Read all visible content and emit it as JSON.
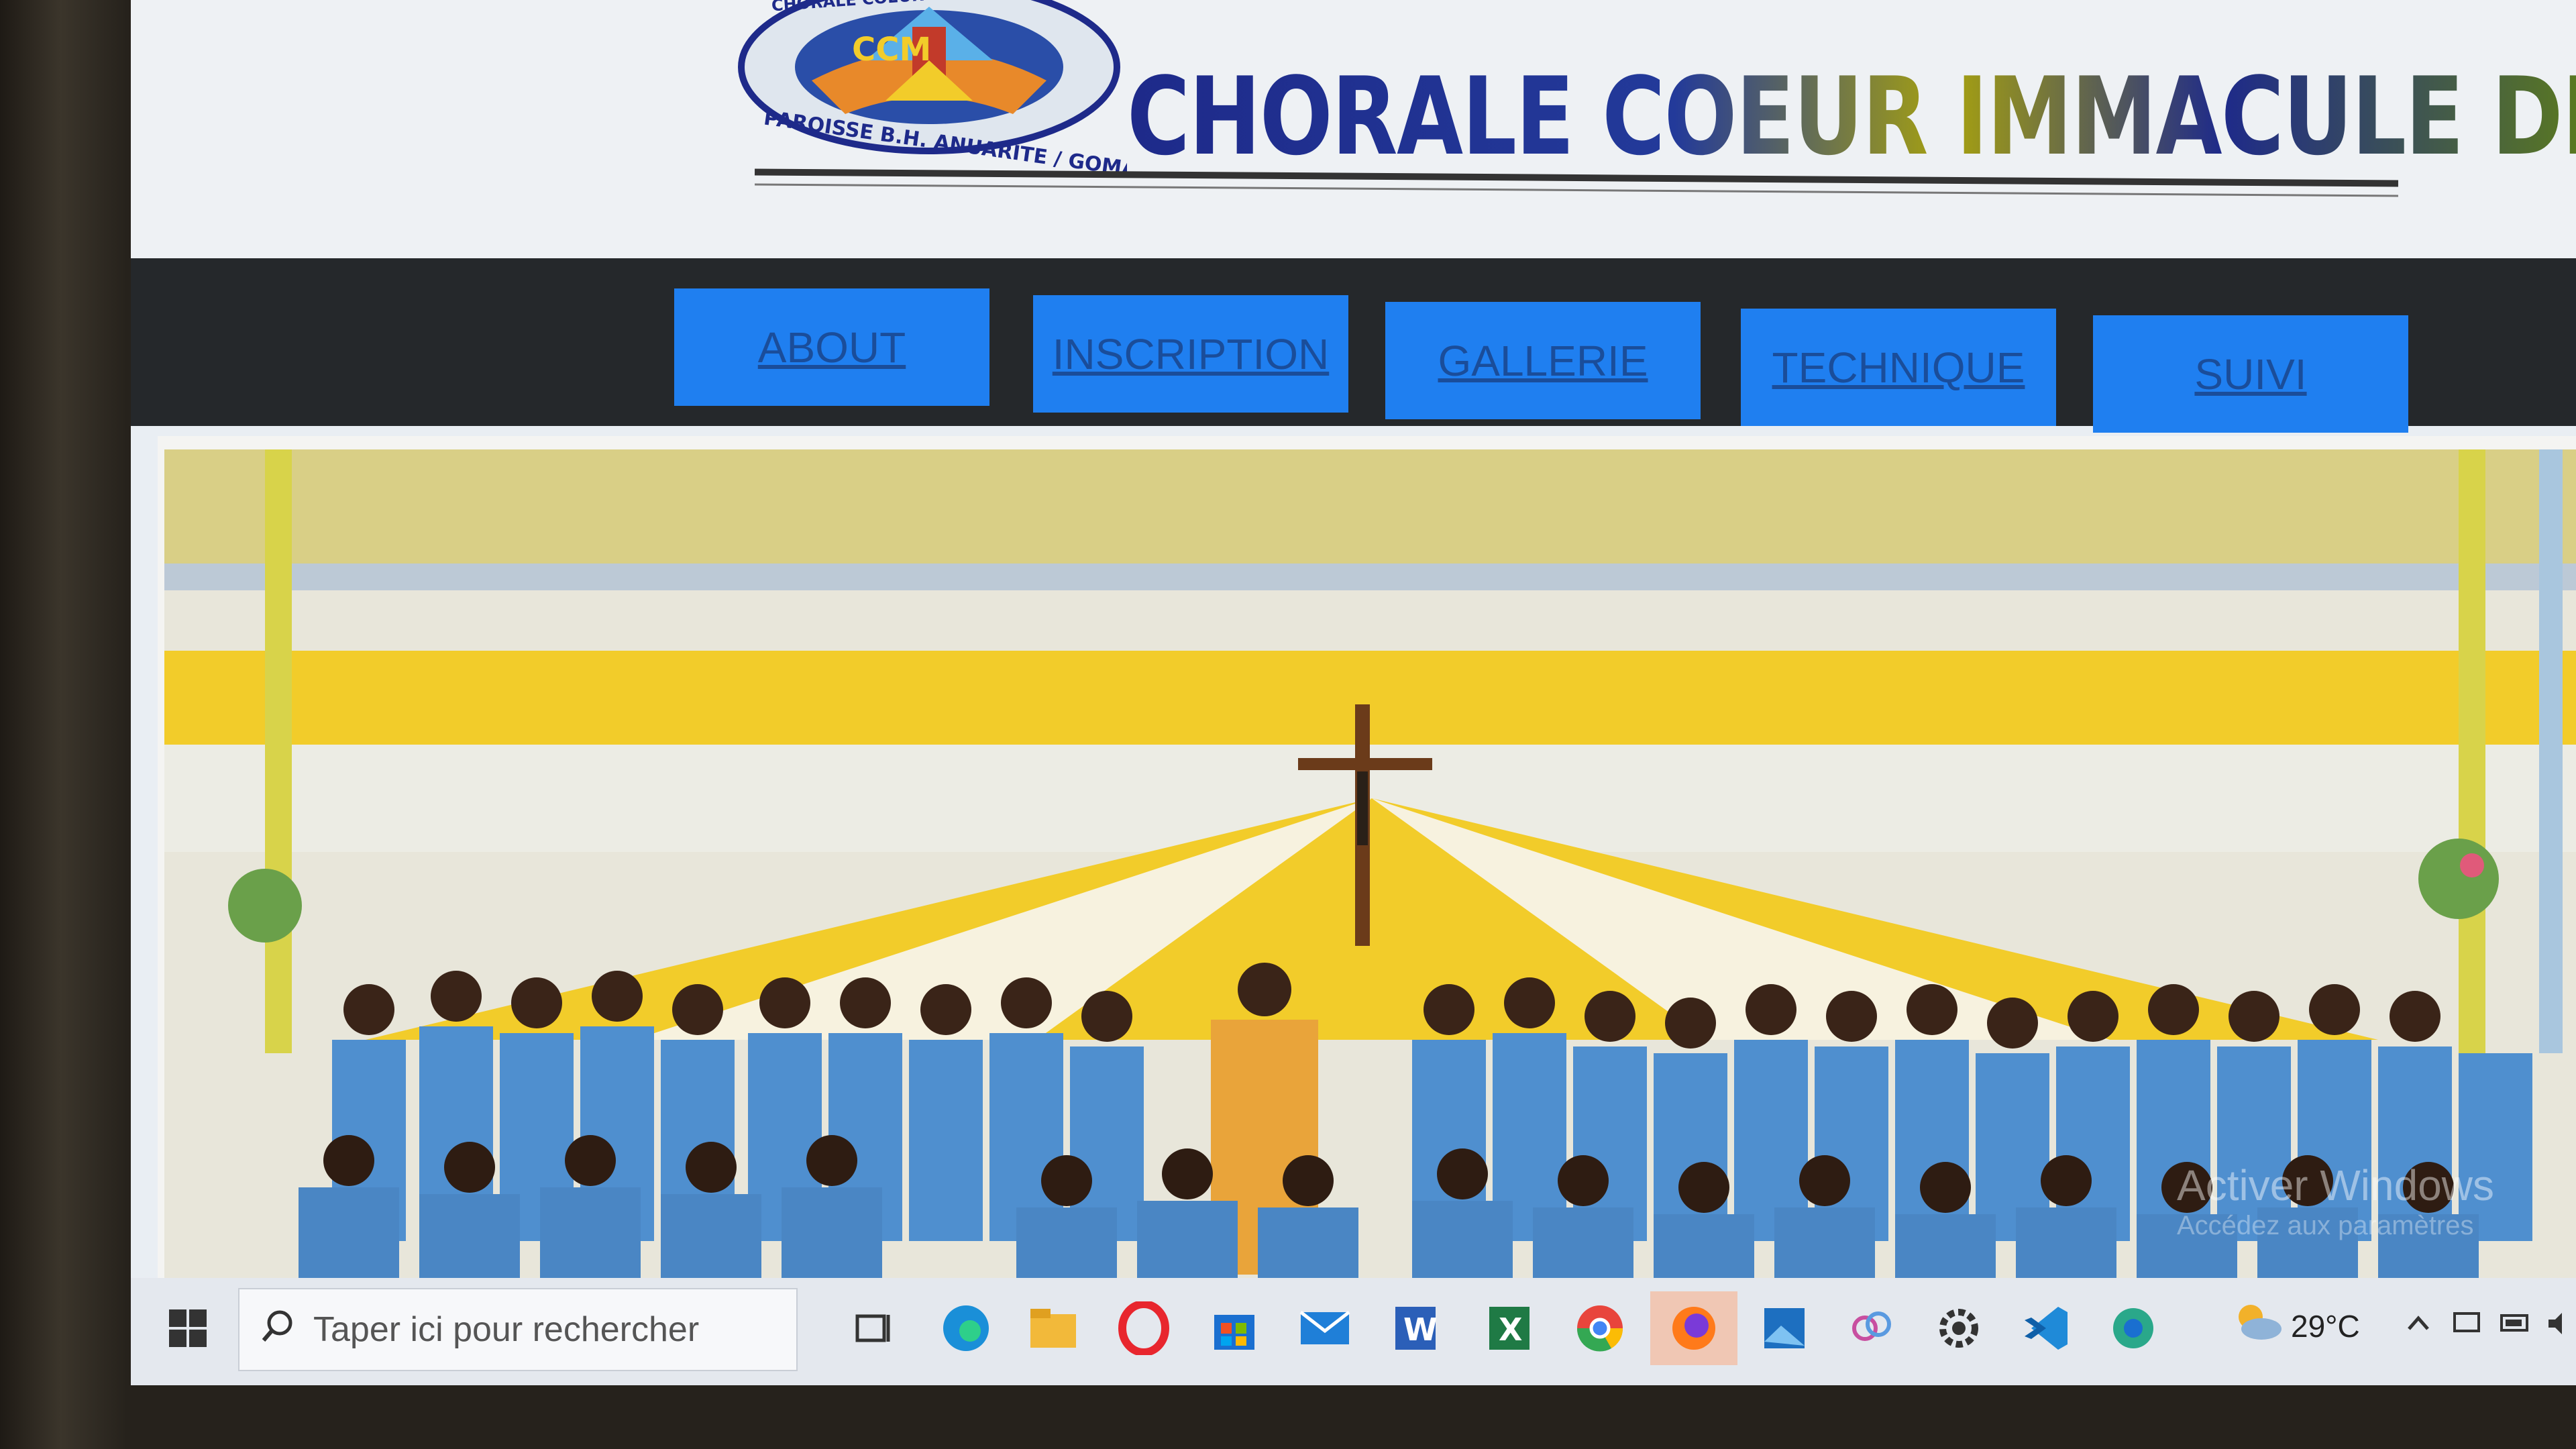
{
  "header": {
    "logo_ring_top": "CHORALE COEUR IMMACULE DE MARIE",
    "logo_ring_bottom": "PAROISSE B.H. ANUARITE / GOMA",
    "logo_letters": "CCM",
    "title": "CHORALE COEUR IMMACULE DE MARIE"
  },
  "nav": {
    "items": [
      {
        "label": "ABOUT"
      },
      {
        "label": "INSCRIPTION"
      },
      {
        "label": "GALLERIE"
      },
      {
        "label": "TECHNIQUE"
      },
      {
        "label": "SUIVI"
      }
    ],
    "button_color": "#1f7ff0",
    "bar_color": "#25282b"
  },
  "banner": {
    "alt": "choir group photo with crucifix",
    "colors": {
      "yellow": "#f2cc2a",
      "vest": "#4f8fcf",
      "tent": "#e8e6da"
    }
  },
  "watermark": {
    "line1": "Activer Windows",
    "line2": "Accédez aux paramètres"
  },
  "taskbar": {
    "search_placeholder": "Taper ici pour rechercher",
    "temperature": "29°C",
    "icons": [
      "windows-start-icon",
      "task-view-icon",
      "edge-icon",
      "file-explorer-icon",
      "opera-icon",
      "store-icon",
      "mail-icon",
      "word-icon",
      "excel-icon",
      "chrome-icon",
      "firefox-icon",
      "photos-icon",
      "paint-icon",
      "settings-icon",
      "vscode-icon",
      "network-app-icon"
    ]
  }
}
